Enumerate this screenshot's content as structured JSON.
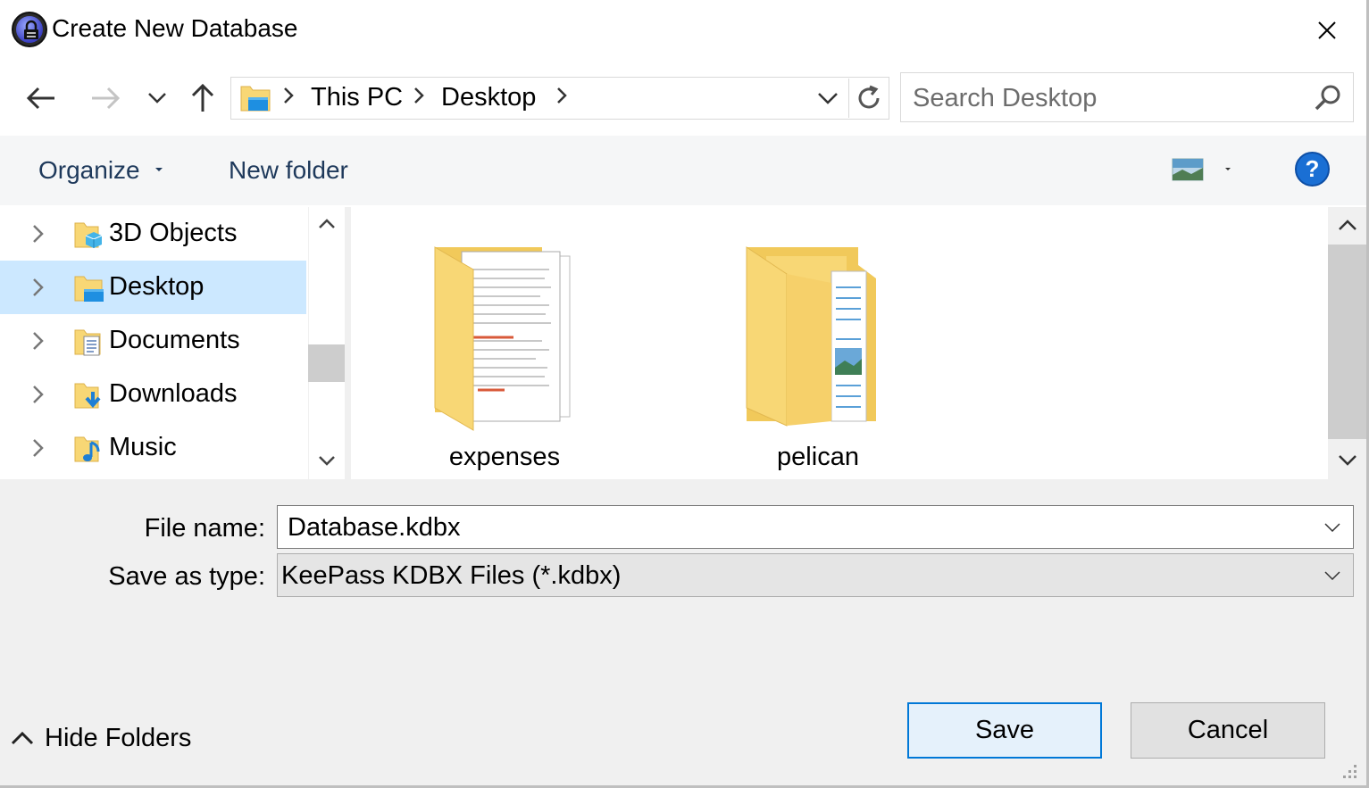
{
  "window": {
    "title": "Create New Database"
  },
  "nav": {
    "breadcrumbs": [
      "This PC",
      "Desktop"
    ],
    "search_placeholder": "Search Desktop"
  },
  "toolbar": {
    "organize_label": "Organize",
    "new_folder_label": "New folder",
    "help_label": "?"
  },
  "tree": {
    "items": [
      {
        "label": "3D Objects",
        "icon": "3d-objects-folder-icon",
        "selected": false
      },
      {
        "label": "Desktop",
        "icon": "desktop-folder-icon",
        "selected": true
      },
      {
        "label": "Documents",
        "icon": "documents-folder-icon",
        "selected": false
      },
      {
        "label": "Downloads",
        "icon": "downloads-folder-icon",
        "selected": false
      },
      {
        "label": "Music",
        "icon": "music-folder-icon",
        "selected": false
      }
    ]
  },
  "files": {
    "items": [
      {
        "label": "expenses",
        "icon": "folder-with-documents-icon"
      },
      {
        "label": "pelican",
        "icon": "folder-with-image-icon"
      }
    ]
  },
  "form": {
    "filename_label": "File name:",
    "filename_value": "Database.kdbx",
    "savetype_label": "Save as type:",
    "savetype_value": "KeePass KDBX Files (*.kdbx)"
  },
  "footer": {
    "hide_folders_label": "Hide Folders",
    "save_label": "Save",
    "cancel_label": "Cancel"
  },
  "colors": {
    "accent": "#0078d7",
    "selection": "#cce8ff",
    "toolbar_text": "#1e395b",
    "folder_yellow": "#f8d775"
  }
}
